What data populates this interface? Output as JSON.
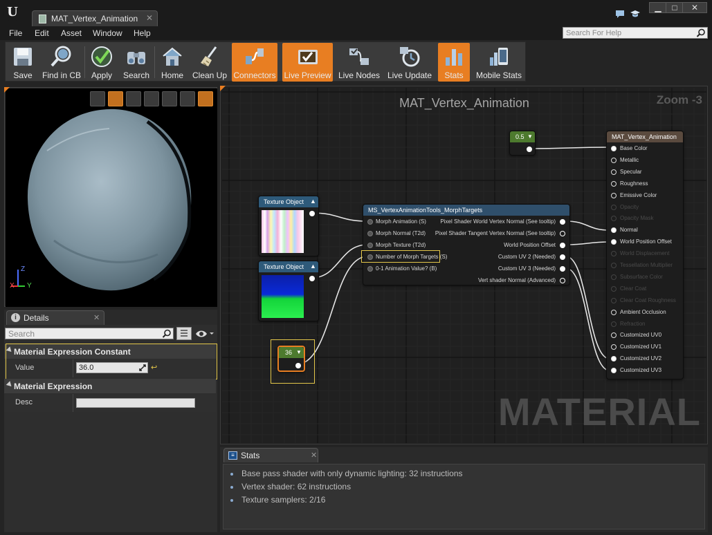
{
  "window": {
    "tab_title": "MAT_Vertex_Animation",
    "logo": "U",
    "minimize_glyph": "▁",
    "maximize_glyph": "□",
    "close_glyph": "✕",
    "tab_close_glyph": "✕"
  },
  "menu": {
    "items": [
      "File",
      "Edit",
      "Asset",
      "Window",
      "Help"
    ],
    "search_placeholder": "Search For Help"
  },
  "toolbar": {
    "buttons": [
      {
        "label": "Save",
        "icon": "save-icon",
        "active": false
      },
      {
        "label": "Find in CB",
        "icon": "find-in-cb-icon",
        "active": false
      },
      {
        "label": "Apply",
        "icon": "apply-checkmark-icon",
        "active": false
      },
      {
        "label": "Search",
        "icon": "binoculars-icon",
        "active": false
      },
      {
        "label": "Home",
        "icon": "home-icon",
        "active": false
      },
      {
        "label": "Clean Up",
        "icon": "broom-icon",
        "active": false
      },
      {
        "label": "Connectors",
        "icon": "connectors-icon",
        "active": true
      },
      {
        "label": "Live Preview",
        "icon": "live-preview-icon",
        "active": true
      },
      {
        "label": "Live Nodes",
        "icon": "live-nodes-icon",
        "active": false
      },
      {
        "label": "Live Update",
        "icon": "live-update-icon",
        "active": false
      },
      {
        "label": "Stats",
        "icon": "stats-bars-icon",
        "active": true
      },
      {
        "label": "Mobile Stats",
        "icon": "mobile-stats-icon",
        "active": false
      }
    ]
  },
  "viewport": {
    "axis_x": "X",
    "axis_y": "Y",
    "axis_z": "Z"
  },
  "details": {
    "tab_label": "Details",
    "search_placeholder": "Search",
    "categories": [
      {
        "title": "Material Expression Constant",
        "props": [
          {
            "label": "Value",
            "value": "36.0"
          }
        ]
      },
      {
        "title": "Material Expression",
        "props": [
          {
            "label": "Desc",
            "value": ""
          }
        ]
      }
    ]
  },
  "graph": {
    "title": "MAT_Vertex_Animation",
    "zoom": "Zoom -3",
    "watermark": "MATERIAL",
    "nodes": {
      "const_a": {
        "value": "0.5"
      },
      "const_b": {
        "value": "36"
      },
      "tex1": {
        "title": "Texture Object"
      },
      "tex2": {
        "title": "Texture Object"
      },
      "morph": {
        "title": "MS_VertexAnimationTools_MorphTargets",
        "inputs": [
          "Morph Animation (S)",
          "Morph Normal (T2d)",
          "Morph Texture (T2d)",
          "Number of Morph Targets (S)",
          "0-1 Animation Value? (B)"
        ],
        "outputs": [
          "Pixel Shader World Vertex Normal (See tooltip)",
          "Pixel Shader Tangent Vertex Normal (See tooltip)",
          "World Position Offset",
          "Custom UV 2 (Needed)",
          "Custom UV 3 (Needed)",
          "Vert shader Normal (Advanced)"
        ]
      },
      "result": {
        "title": "MAT_Vertex_Animation",
        "inputs": [
          "Base Color",
          "Metallic",
          "Specular",
          "Roughness",
          "Emissive Color",
          "Opacity",
          "Opacity Mask",
          "Normal",
          "World Position Offset",
          "World Displacement",
          "Tessellation Multiplier",
          "Subsurface Color",
          "Clear Coat",
          "Clear Coat Roughness",
          "Ambient Occlusion",
          "Refraction",
          "Customized UV0",
          "Customized UV1",
          "Customized UV2",
          "Customized UV3"
        ],
        "disabled": [
          false,
          false,
          false,
          false,
          false,
          true,
          true,
          false,
          false,
          true,
          true,
          true,
          true,
          true,
          false,
          true,
          false,
          false,
          false,
          false
        ]
      }
    }
  },
  "stats": {
    "tab_label": "Stats",
    "lines": [
      "Base pass shader with only dynamic lighting: 32 instructions",
      "Vertex shader: 62 instructions",
      "Texture samplers: 2/16"
    ]
  },
  "colors": {
    "accent": "#e87e22",
    "highlight": "#e5c84a",
    "texture_header": "#2e5a7a",
    "function_header": "#2f4f6b",
    "constant_header": "#4d7a2e",
    "result_header": "#5a4a3e"
  }
}
